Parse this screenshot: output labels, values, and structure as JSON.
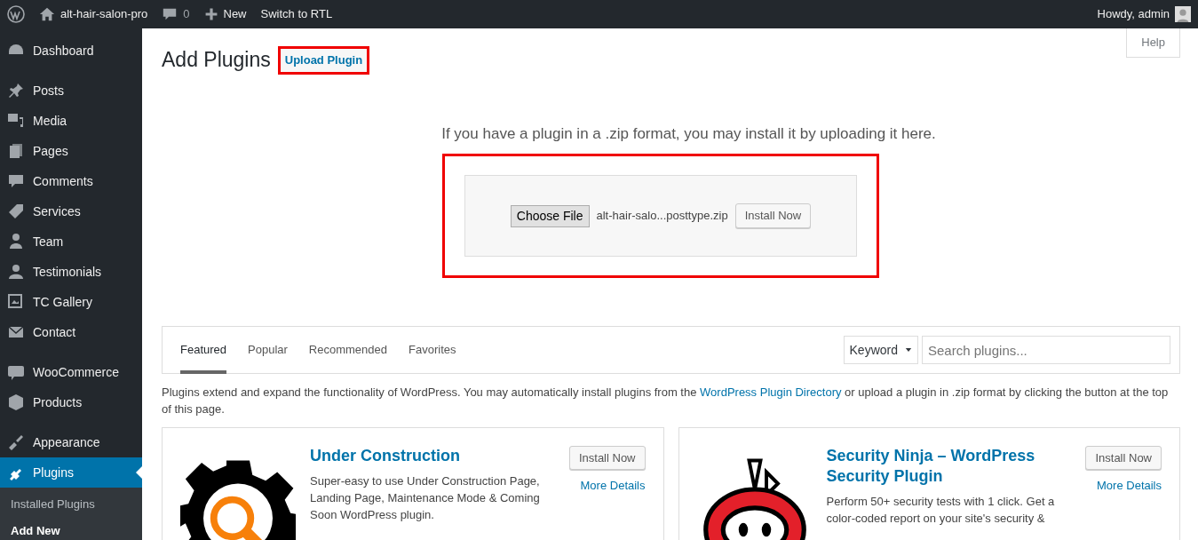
{
  "admin_bar": {
    "site_name": "alt-hair-salon-pro",
    "comments_count": "0",
    "new_label": "New",
    "rtl_label": "Switch to RTL",
    "greeting": "Howdy, admin"
  },
  "sidebar": {
    "groups": [
      [
        {
          "label": "Dashboard",
          "selected": false
        }
      ],
      [
        {
          "label": "Posts",
          "selected": false
        },
        {
          "label": "Media",
          "selected": false
        },
        {
          "label": "Pages",
          "selected": false
        },
        {
          "label": "Comments",
          "selected": false
        },
        {
          "label": "Services",
          "selected": false
        },
        {
          "label": "Team",
          "selected": false
        },
        {
          "label": "Testimonials",
          "selected": false
        },
        {
          "label": "TC Gallery",
          "selected": false
        },
        {
          "label": "Contact",
          "selected": false
        }
      ],
      [
        {
          "label": "WooCommerce",
          "selected": false
        },
        {
          "label": "Products",
          "selected": false
        }
      ],
      [
        {
          "label": "Appearance",
          "selected": false
        },
        {
          "label": "Plugins",
          "selected": true,
          "children": [
            {
              "label": "Installed Plugins",
              "selected": false
            },
            {
              "label": "Add New",
              "selected": true
            }
          ]
        }
      ]
    ]
  },
  "help_label": "Help",
  "page_title": "Add Plugins",
  "upload_button": "Upload Plugin",
  "upload_hint": "If you have a plugin in a .zip format, you may install it by uploading it here.",
  "upload_form": {
    "choose_label": "Choose File",
    "file_name": "alt-hair-salo...posttype.zip",
    "install_label": "Install Now"
  },
  "tabs": [
    {
      "label": "Featured",
      "selected": true
    },
    {
      "label": "Popular",
      "selected": false
    },
    {
      "label": "Recommended",
      "selected": false
    },
    {
      "label": "Favorites",
      "selected": false
    }
  ],
  "search": {
    "type_value": "Keyword",
    "placeholder": "Search plugins..."
  },
  "intro": {
    "before": "Plugins extend and expand the functionality of WordPress. You may automatically install plugins from the ",
    "link": "WordPress Plugin Directory",
    "after": " or upload a plugin in .zip format by clicking the button at the top of this page."
  },
  "plugins": [
    {
      "kind": "gear",
      "name": "Under Construction",
      "description": "Super-easy to use Under Construction Page, Landing Page, Maintenance Mode & Coming Soon WordPress plugin.",
      "install_label": "Install Now",
      "details_label": "More Details"
    },
    {
      "kind": "ninja",
      "name": "Security Ninja – WordPress Security Plugin",
      "description": "Perform 50+ security tests with 1 click. Get a color-coded report on your site's security &",
      "install_label": "Install Now",
      "details_label": "More Details"
    }
  ]
}
